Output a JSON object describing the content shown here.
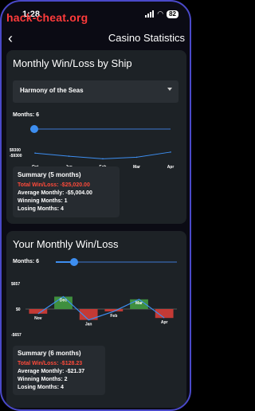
{
  "status": {
    "time": "1:28",
    "battery": "82",
    "watermark": "hack-cheat.org"
  },
  "nav": {
    "title": "Casino Statistics"
  },
  "ship_card": {
    "title": "Monthly Win/Loss by Ship",
    "selected_ship": "Harmony of the Seas",
    "months_label": "Months: 6",
    "months": 6,
    "summary": {
      "title": "Summary (5 months)",
      "total": "Total Win/Loss: -$25,020.00",
      "average": "Average Monthly: -$5,004.00",
      "winning": "Winning Months: 1",
      "losing": "Losing Months: 4"
    }
  },
  "my_card": {
    "title": "Your Monthly Win/Loss",
    "months_label": "Months: 6",
    "months": 6,
    "summary": {
      "title": "Summary (6 months)",
      "total": "Total Win/Loss: -$128.23",
      "average": "Average Monthly: -$21.37",
      "winning": "Winning Months: 2",
      "losing": "Losing Months: 4"
    }
  },
  "colors": {
    "accent": "#3d8ef0",
    "win": "#3f8f3f",
    "loss": "#c43a35",
    "loss_text": "#ff4a3a"
  },
  "chart_data": [
    {
      "type": "line",
      "categories": [
        "Oct",
        "Jan",
        "Feb",
        "Mar",
        "Apr"
      ],
      "y_tick_labels": [
        "$9300",
        "-$9300"
      ],
      "ylim": [
        -9300,
        9300
      ],
      "series": [
        {
          "values": [
            -2500,
            -5500,
            -8000,
            -6500,
            -1500
          ]
        }
      ]
    },
    {
      "type": "bar",
      "categories": [
        "Nov",
        "Dec",
        "Jan",
        "Feb",
        "Mar",
        "Apr"
      ],
      "y_tick_labels": [
        "$657",
        "$0",
        "-$657"
      ],
      "ylim": [
        -657,
        657
      ],
      "series": [
        {
          "values": [
            -120,
            320,
            -280,
            -60,
            250,
            -230
          ]
        }
      ]
    }
  ]
}
